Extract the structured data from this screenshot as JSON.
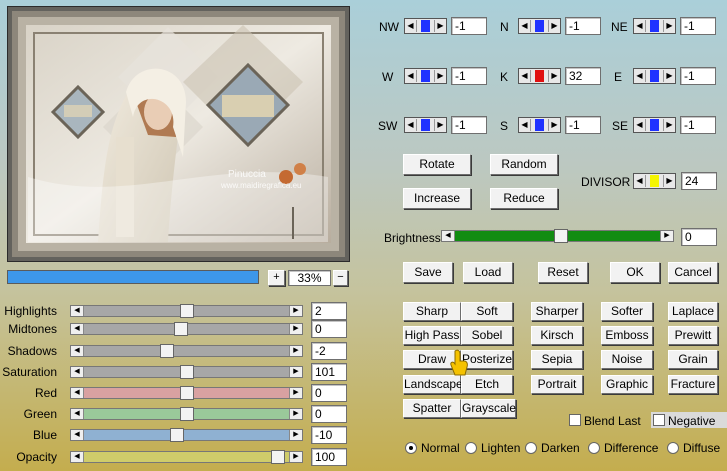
{
  "preview": {
    "watermark": "Pinuccia",
    "watermark_url": "www.maidiregrafica.eu",
    "zoom_label": "33%",
    "zoom_in": "+",
    "zoom_out": "−",
    "progress_fraction": 1.0
  },
  "adjust": [
    {
      "label": "Highlights",
      "value": "2",
      "pos": 0.5
    },
    {
      "label": "Midtones",
      "value": "0",
      "pos": 0.47
    },
    {
      "label": "Shadows",
      "value": "-2",
      "pos": 0.4
    },
    {
      "label": "Saturation",
      "value": "101",
      "pos": 0.5
    },
    {
      "label": "Red",
      "value": "0",
      "pos": 0.5,
      "color": "#d9a1a1"
    },
    {
      "label": "Green",
      "value": "0",
      "pos": 0.5,
      "color": "#9ac99a"
    },
    {
      "label": "Blue",
      "value": "-10",
      "pos": 0.45,
      "color": "#8fb1d2"
    },
    {
      "label": "Opacity",
      "value": "100",
      "pos": 0.98,
      "color": "#cfcc6a"
    }
  ],
  "kernel": {
    "nw": {
      "label": "NW",
      "value": "-1"
    },
    "n": {
      "label": "N",
      "value": "-1"
    },
    "ne": {
      "label": "NE",
      "value": "-1"
    },
    "w": {
      "label": "W",
      "value": "-1"
    },
    "k": {
      "label": "K",
      "value": "32"
    },
    "e": {
      "label": "E",
      "value": "-1"
    },
    "sw": {
      "label": "SW",
      "value": "-1"
    },
    "s": {
      "label": "S",
      "value": "-1"
    },
    "se": {
      "label": "SE",
      "value": "-1"
    },
    "divisor": {
      "label": "DIVISOR",
      "value": "24"
    }
  },
  "buttons": {
    "rotate": "Rotate",
    "random": "Random",
    "increase": "Increase",
    "reduce": "Reduce",
    "save": "Save",
    "load": "Load",
    "reset": "Reset",
    "ok": "OK",
    "cancel": "Cancel"
  },
  "brightness": {
    "label": "Brightness",
    "value": "0",
    "pos": 0.52
  },
  "presets": [
    [
      "Sharp",
      "Soft",
      "Sharper",
      "Softer",
      "Laplace"
    ],
    [
      "High Pass",
      "Sobel",
      "Kirsch",
      "Emboss",
      "Prewitt"
    ],
    [
      "Draw",
      "Posterize",
      "Sepia",
      "Noise",
      "Grain"
    ],
    [
      "Landscape",
      "Etch",
      "Portrait",
      "Graphic",
      "Fracture"
    ],
    [
      "Spatter",
      "Grayscale"
    ]
  ],
  "options": {
    "blend_last": "Blend Last",
    "negative": "Negative"
  },
  "modes": [
    "Normal",
    "Lighten",
    "Darken",
    "Difference",
    "Diffuse"
  ],
  "colors": {
    "accent_blue": "#1f32ff",
    "k_red": "#e01010",
    "divisor_yellow": "#f5f500",
    "brightness_green": "#128c12",
    "progress_blue": "#3d97ea"
  }
}
